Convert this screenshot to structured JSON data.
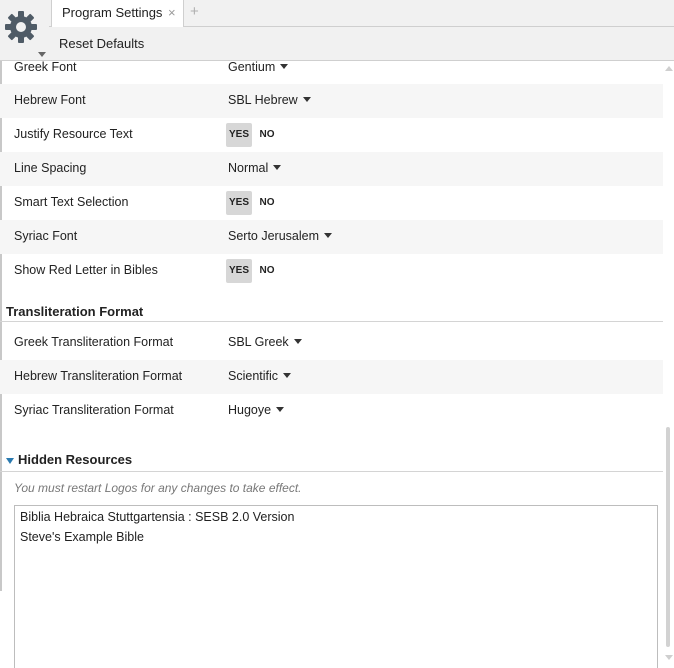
{
  "window": {
    "tab_title": "Program Settings",
    "tab_close_glyph": "×",
    "tab_add_glyph": "+",
    "settings_icon": "gear-icon"
  },
  "toolbar": {
    "reset_label": "Reset Defaults"
  },
  "settings": [
    {
      "label": "Greek Font",
      "type": "dropdown",
      "value": "Gentium"
    },
    {
      "label": "Hebrew Font",
      "type": "dropdown",
      "value": "SBL Hebrew"
    },
    {
      "label": "Justify Resource Text",
      "type": "toggle",
      "yes": "YES",
      "no": "NO",
      "selected": "YES"
    },
    {
      "label": "Line Spacing",
      "type": "dropdown",
      "value": "Normal"
    },
    {
      "label": "Smart Text Selection",
      "type": "toggle",
      "yes": "YES",
      "no": "NO",
      "selected": "YES"
    },
    {
      "label": "Syriac Font",
      "type": "dropdown",
      "value": "Serto Jerusalem"
    },
    {
      "label": "Show Red Letter in Bibles",
      "type": "toggle",
      "yes": "YES",
      "no": "NO",
      "selected": "YES"
    }
  ],
  "transliteration": {
    "heading": "Transliteration Format",
    "items": [
      {
        "label": "Greek Transliteration Format",
        "value": "SBL Greek"
      },
      {
        "label": "Hebrew Transliteration Format",
        "value": "Scientific"
      },
      {
        "label": "Syriac Transliteration Format",
        "value": "Hugoye"
      }
    ]
  },
  "hidden_resources": {
    "heading": "Hidden Resources",
    "hint": "You must restart Logos for any changes to take effect.",
    "items": [
      "Biblia Hebraica Stuttgartensia : SESB 2.0 Version",
      "Steve's Example Bible"
    ]
  },
  "colors": {
    "accent": "#2a7ab0",
    "toggle_selected_bg": "#d7d7d7",
    "row_alt_bg": "#f6f6f6"
  }
}
